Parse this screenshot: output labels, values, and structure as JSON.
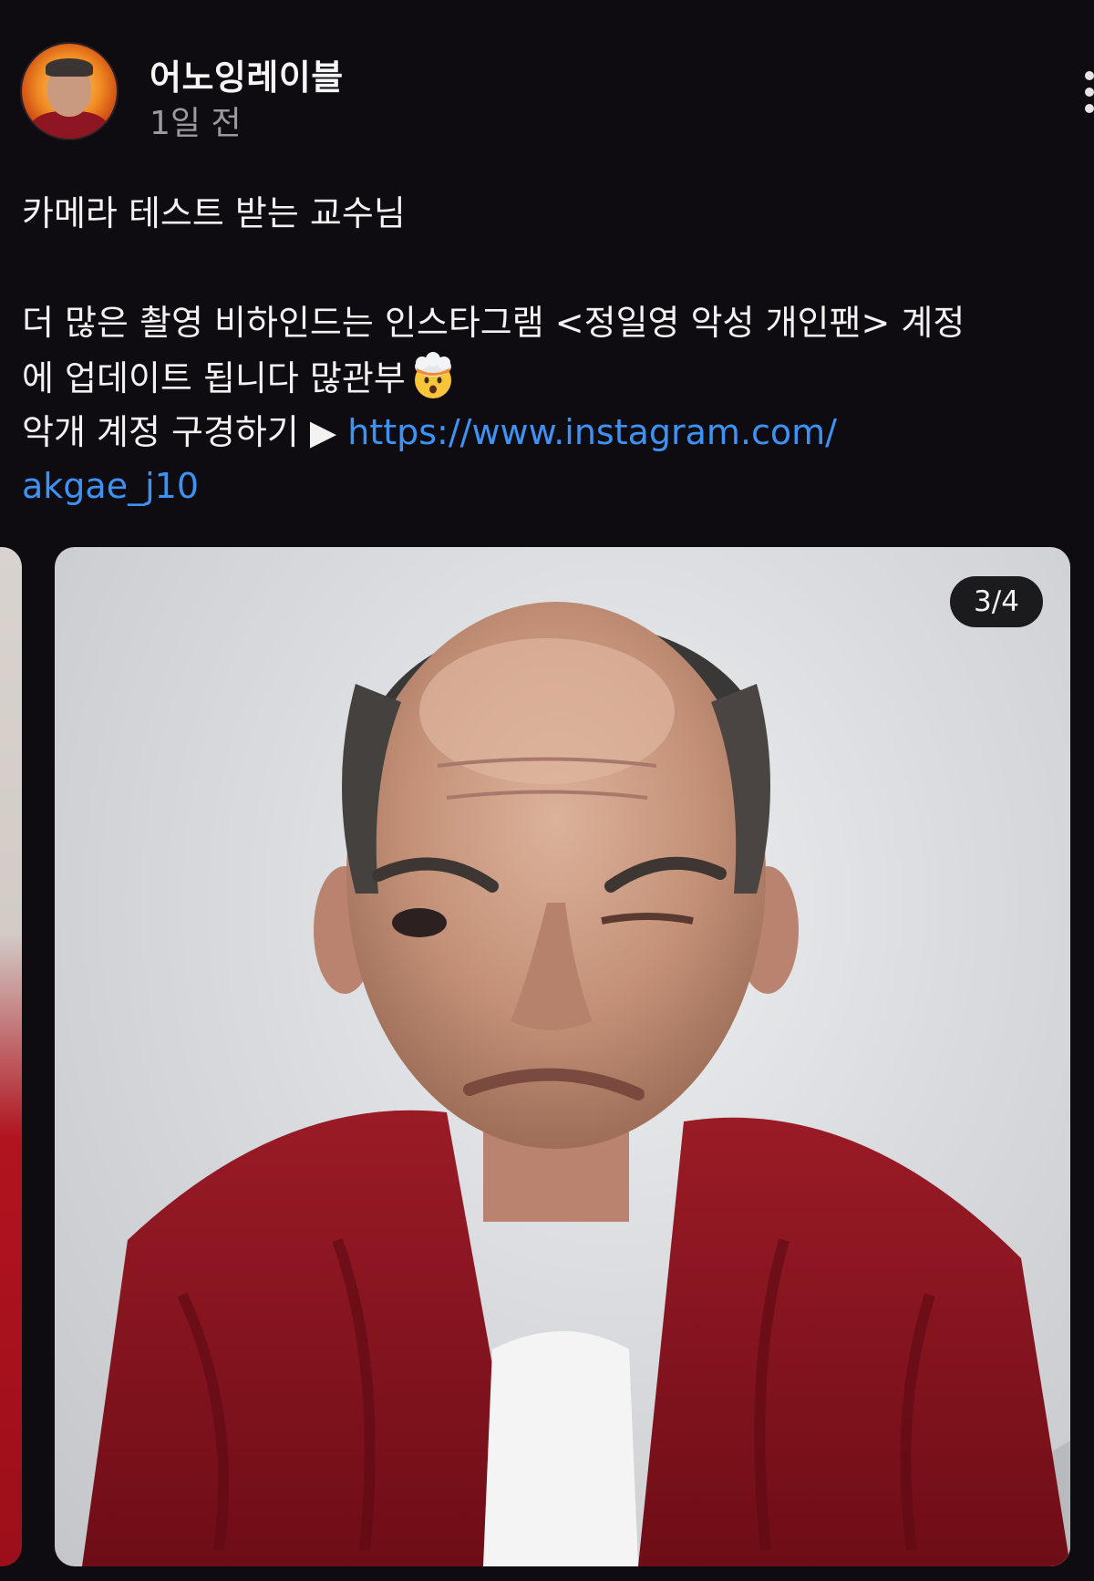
{
  "post": {
    "username": "어노잉레이블",
    "time": "1일 전",
    "caption_line1": "카메라 테스트 받는 교수님",
    "caption_line2a": "더 많은 촬영 비하인드는 인스타그램 <정일영 악성 개인팬> 계정",
    "caption_line2b": "에 업데이트 됩니다 많관부",
    "caption_line3_prefix": "악개 계정 구경하기 ▶ ",
    "link_text_1": "https://www.instagram.com/",
    "link_text_2": "akgae_j10"
  },
  "carousel": {
    "indicator": "3/4"
  },
  "icons": {
    "more": "more-vertical-icon",
    "emoji": "exploding-head-emoji"
  },
  "colors": {
    "background": "#0e0c10",
    "link": "#3d93f5",
    "muted": "#9b9aa0"
  }
}
